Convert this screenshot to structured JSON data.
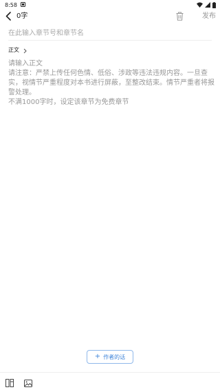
{
  "status_bar": {
    "time": "8:58"
  },
  "header": {
    "word_count": "0字",
    "publish_label": "发布"
  },
  "chapter_title": {
    "placeholder": "在此输入章节号和章节名",
    "value": ""
  },
  "volume": {
    "label": "正文"
  },
  "content": {
    "placeholder_lines": [
      "请输入正文",
      "请注意：严禁上传任何色情、低俗、涉政等违法违规内容。一旦查实，视情节严重程度对本书进行屏蔽，至整改结束。情节严重者将报警处理。",
      "不满1000字时，设定该章节为免费章节"
    ]
  },
  "author_note": {
    "label": "作者的话"
  },
  "icons": {
    "back": "chevron-left-icon",
    "trash": "trash-icon",
    "volume_arrow": "chevron-right-icon",
    "author_note_plus": "plus-icon",
    "layout_toggle": "columns-icon",
    "insert_image": "image-icon"
  },
  "colors": {
    "accent": "#3d83d9",
    "placeholder_text": "#999999",
    "publish_disabled": "#9a9a9a"
  }
}
